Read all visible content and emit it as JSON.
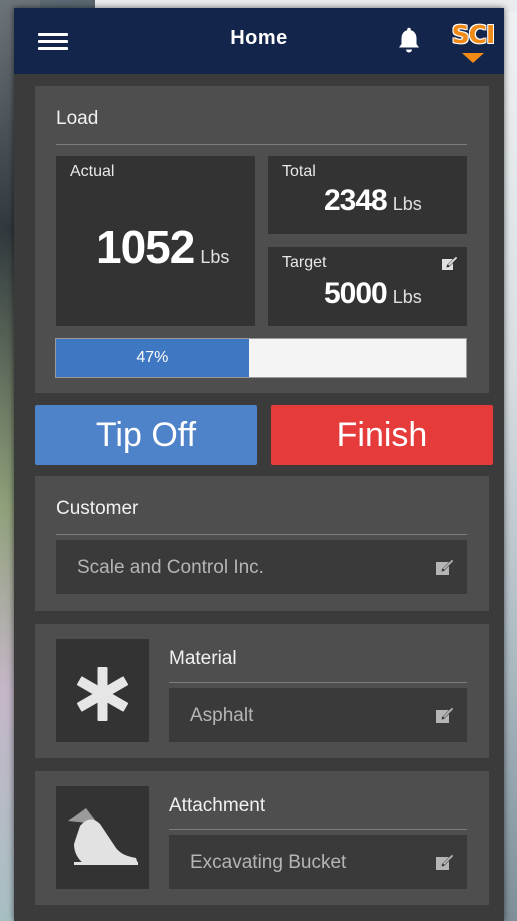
{
  "header": {
    "title": "Home",
    "menu_icon": "hamburger-menu-icon",
    "bell_icon": "bell-icon",
    "logo_text": "SCI"
  },
  "load": {
    "title": "Load",
    "actual": {
      "label": "Actual",
      "value": "1052",
      "unit": "Lbs"
    },
    "total": {
      "label": "Total",
      "value": "2348",
      "unit": "Lbs"
    },
    "target": {
      "label": "Target",
      "value": "5000",
      "unit": "Lbs",
      "edit_icon": "edit-icon"
    },
    "progress": {
      "percent": 47,
      "label": "47%"
    }
  },
  "actions": {
    "tip_off_label": "Tip Off",
    "finish_label": "Finish"
  },
  "customer": {
    "title": "Customer",
    "value": "Scale and Control Inc.",
    "edit_icon": "edit-icon"
  },
  "material": {
    "title": "Material",
    "value": "Asphalt",
    "icon": "asterisk-icon",
    "edit_icon": "edit-icon"
  },
  "attachment": {
    "title": "Attachment",
    "value": "Excavating Bucket",
    "icon": "bucket-icon",
    "edit_icon": "edit-icon"
  },
  "colors": {
    "header_bg": "#13254a",
    "accent_blue": "#4e82c9",
    "accent_red": "#e63b3b",
    "logo_orange": "#f28a17",
    "panel_bg": "#4e4e4e"
  }
}
